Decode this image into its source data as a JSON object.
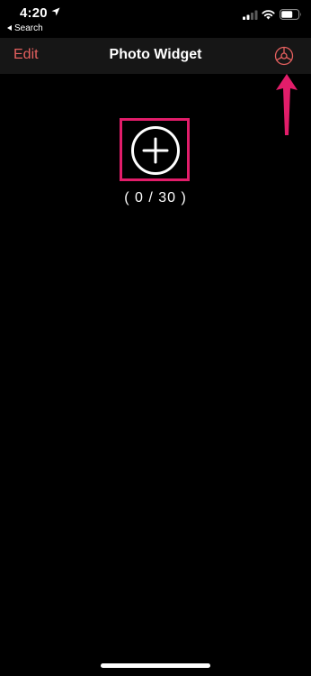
{
  "status_bar": {
    "time": "4:20",
    "back_label": "Search",
    "icons": [
      "location-arrow-icon",
      "cellular-signal-icon",
      "wifi-icon",
      "battery-icon"
    ]
  },
  "nav": {
    "edit_label": "Edit",
    "title": "Photo Widget",
    "settings_icon": "gear-icon"
  },
  "main": {
    "add_icon": "plus-circle-icon",
    "photo_count": "( 0 / 30 )"
  },
  "colors": {
    "background": "#000000",
    "nav_background": "#161616",
    "accent": "#e5605f",
    "annotation": "#e21d6a",
    "text": "#ffffff"
  }
}
